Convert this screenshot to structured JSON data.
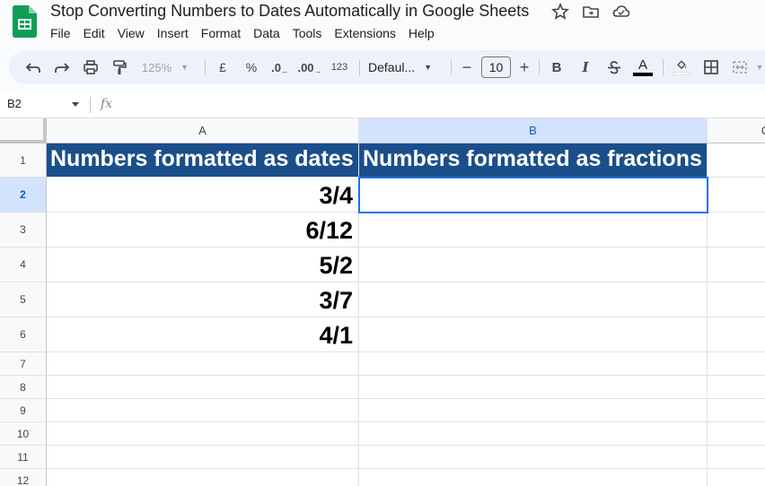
{
  "app": {
    "title": "Stop Converting Numbers to Dates Automatically in Google Sheets",
    "menu": [
      "File",
      "Edit",
      "View",
      "Insert",
      "Format",
      "Data",
      "Tools",
      "Extensions",
      "Help"
    ]
  },
  "toolbar": {
    "zoom": "125%",
    "currency": "£",
    "percent": "%",
    "decrease_decimals": ".0",
    "increase_decimals": ".00",
    "number_format": "123",
    "font_family": "Defaul...",
    "font_size": "10",
    "bold": "B",
    "italic": "I",
    "text_color": "A"
  },
  "formula_bar": {
    "name_box": "B2",
    "fx": "fx",
    "value": ""
  },
  "sheet": {
    "columns": [
      "A",
      "B",
      "C"
    ],
    "rows": [
      "1",
      "2",
      "3",
      "4",
      "5",
      "6",
      "7",
      "8",
      "9",
      "10",
      "11",
      "12"
    ],
    "selected_cell": "B2",
    "header_row": {
      "a": "Numbers formatted as dates",
      "b": "Numbers formatted as fractions"
    },
    "values_a": [
      "3/4",
      "6/12",
      "5/2",
      "3/7",
      "4/1"
    ],
    "values_b": [
      "",
      "",
      "",
      "",
      ""
    ]
  },
  "colors": {
    "header_fill": "#1a4f8b",
    "header_text": "#ffffff",
    "selection": "#1a73e8",
    "selected_header": "#d3e3fd",
    "logo_green": "#0f9d58"
  }
}
